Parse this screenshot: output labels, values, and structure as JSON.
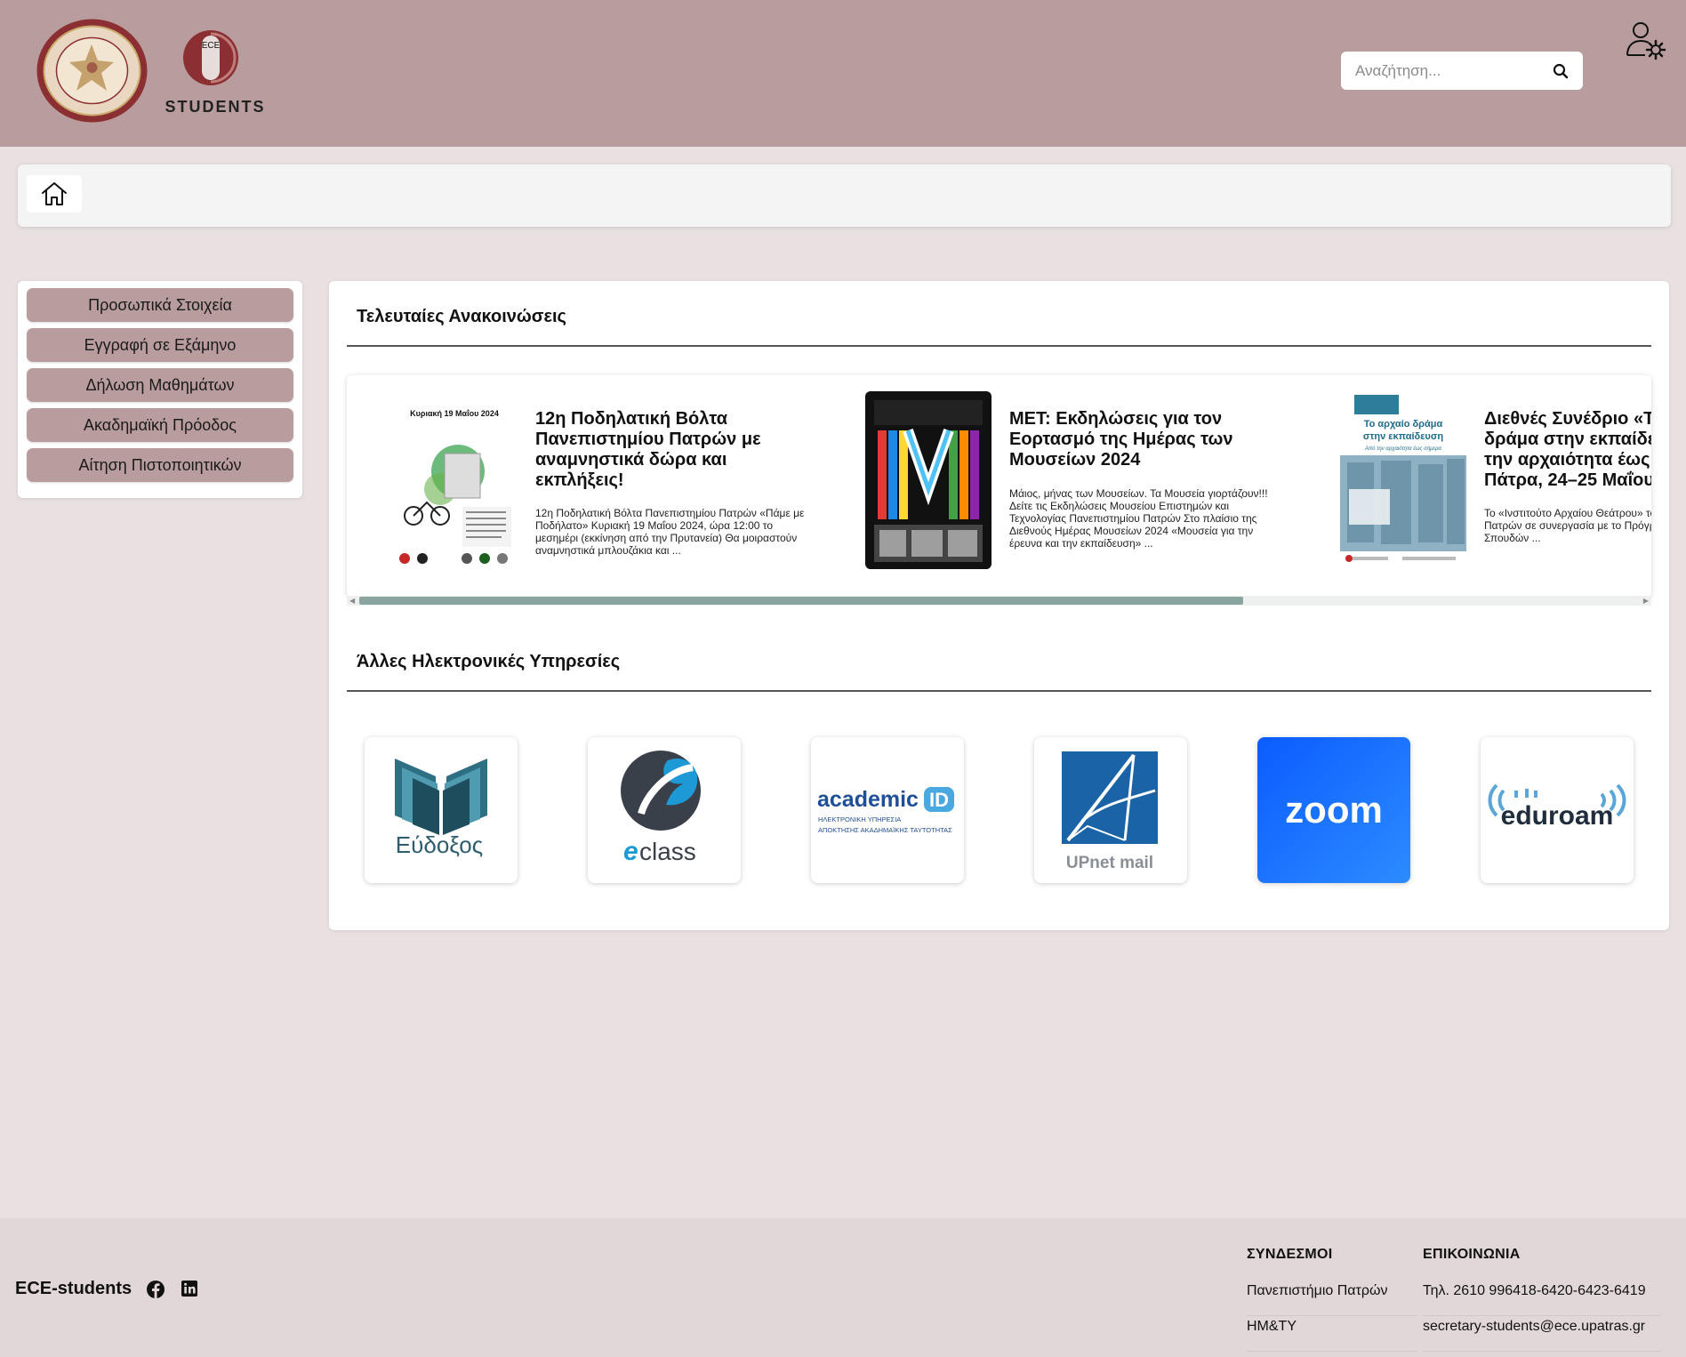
{
  "header": {
    "university_logo_icon": "university-of-patras-seal",
    "ece_logo_text": "STUDENTS",
    "ece_logo_letters": "ECE",
    "search": {
      "placeholder": "Αναζήτηση...",
      "value": ""
    },
    "user_settings_icon": "user-settings-icon"
  },
  "breadcrumb": {
    "home_icon": "home-icon"
  },
  "sidebar": {
    "items": [
      {
        "label": "Προσωπικά Στοιχεία"
      },
      {
        "label": "Εγγραφή σε Εξάμηνο"
      },
      {
        "label": "Δήλωση Μαθημάτων"
      },
      {
        "label": "Ακαδημαϊκή Πρόοδος"
      },
      {
        "label": "Αίτηση Πιστοποιητικών"
      }
    ]
  },
  "announcements": {
    "title": "Τελευταίες Ανακοινώσεις",
    "items": [
      {
        "title": "12η Ποδηλατική Βόλτα Πανεπιστημίου Πατρών με αναμνηστικά δώρα και εκπλήξεις!",
        "description": "12η Ποδηλατική Βόλτα Πανεπιστημίου Πατρών «Πάμε με Ποδήλατο» Κυριακή 19 Μαΐου 2024, ώρα 12:00 το μεσημέρι (εκκίνηση από την Πρυτανεία) Θα μοιραστούν αναμνηστικά μπλουζάκια και ...",
        "poster_heading": "Κυριακή 19 Μαΐου 2024"
      },
      {
        "title": "ΜΕΤ: Εκδηλώσεις για τον Εορτασμό της Ημέρας των Μουσείων 2024",
        "description": "Μάιος, μήνας των Μουσείων. Τα Μουσεία γιορτάζουν!!! Δείτε τις Εκδηλώσεις Μουσείου Επιστημών και Τεχνολογίας Πανεπιστημίου Πατρών Στο πλαίσιο της Διεθνούς Ημέρας Μουσείων 2024 «Μουσεία για την έρευνα και την εκπαίδευση» ..."
      },
      {
        "title": "Διεθνές Συνέδριο «Το αρχαίο δράμα στην εκπαίδευση: Από την αρχαιότητα έως σήμερα», Πάτρα, 24–25 Μαΐου",
        "description": "Το «Ινστιτούτο Αρχαίου Θεάτρου» του Πανεπιστημίου Πατρών σε συνεργασία με το Πρόγραμμα Μεταπτυχιακών Σπουδών ...",
        "poster_heading": "Το αρχαίο δράμα στην εκπαίδευση",
        "poster_subheading": "Από την αρχαιότητα έως σήμερα"
      }
    ]
  },
  "services": {
    "title": "Άλλες Ηλεκτρονικές Υπηρεσίες",
    "items": [
      {
        "name": "Εύδοξος",
        "icon": "eudoxus-book-icon"
      },
      {
        "name": "class",
        "prefix": "e",
        "icon": "eclass-icon"
      },
      {
        "name": "academic",
        "badge": "ID",
        "line1": "ΗΛΕΚΤΡΟΝΙΚΗ ΥΠΗΡΕΣΙΑ",
        "line2": "ΑΠΟΚΤΗΣΗΣ ΑΚΑΔΗΜΑΪΚΗΣ ΤΑΥΤΟΤΗΤΑΣ",
        "icon": "academic-id-icon"
      },
      {
        "name": "UPnet mail",
        "icon": "upnet-mail-icon"
      },
      {
        "name": "zoom",
        "icon": "zoom-icon"
      },
      {
        "name": "eduroam",
        "icon": "eduroam-icon"
      }
    ]
  },
  "footer": {
    "brand": "ECE-students",
    "social": [
      "facebook-icon",
      "linkedin-icon"
    ],
    "links_title": "ΣΥΝΔΕΣΜΟΙ",
    "links": [
      "Πανεπιστήμιο Πατρών",
      "ΗΜ&ΤΥ"
    ],
    "contact_title": "ΕΠΙΚΟΙΝΩΝΙΑ",
    "contact": [
      "Τηλ. 2610 996418-6420-6423-6419",
      "secretary-students@ece.upatras.gr"
    ]
  },
  "colors": {
    "header_bg": "#b99d9e",
    "page_bg": "#e8e0e1",
    "accent": "#b99d9e",
    "footer_bg": "#e1d7d8"
  }
}
